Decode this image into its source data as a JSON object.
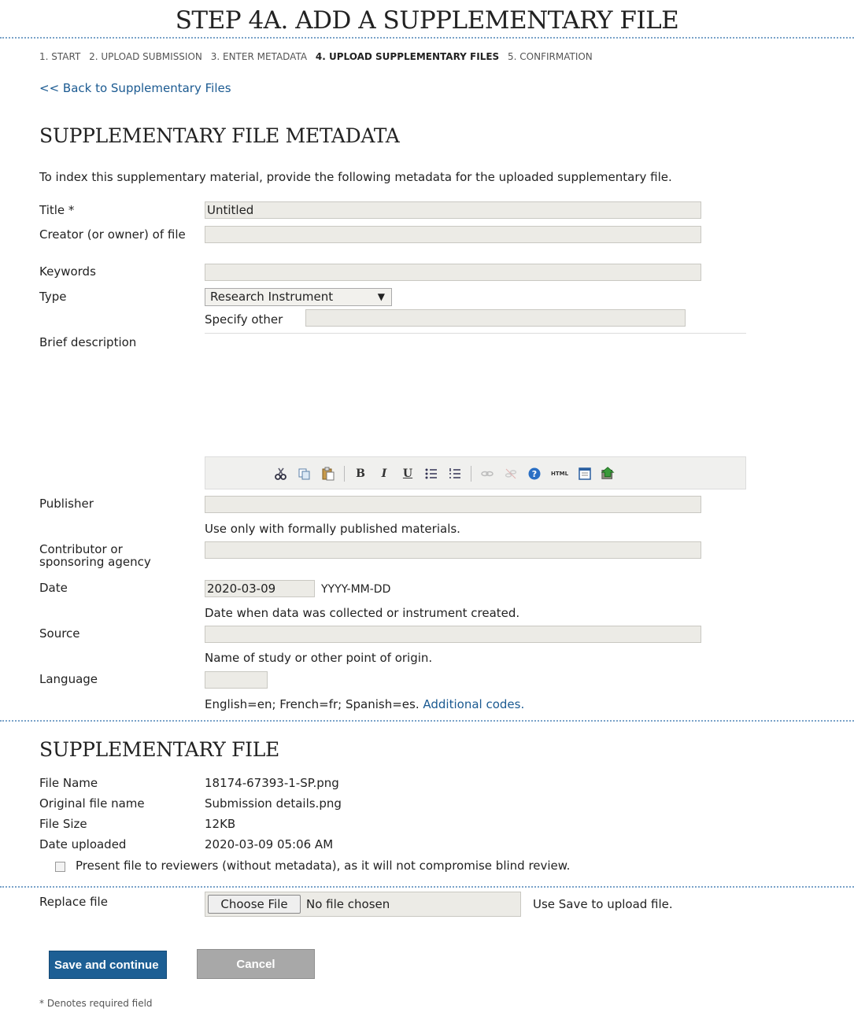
{
  "page_title": "STEP 4A. ADD A SUPPLEMENTARY FILE",
  "steps": [
    {
      "label": "1. START",
      "current": false
    },
    {
      "label": "2. UPLOAD SUBMISSION",
      "current": false
    },
    {
      "label": "3. ENTER METADATA",
      "current": false
    },
    {
      "label": "4. UPLOAD SUPPLEMENTARY FILES",
      "current": true
    },
    {
      "label": "5. CONFIRMATION",
      "current": false
    }
  ],
  "back_link": "<< Back to Supplementary Files",
  "metadata_section": {
    "heading": "SUPPLEMENTARY FILE METADATA",
    "intro": "To index this supplementary material, provide the following metadata for the uploaded supplementary file.",
    "title_label": "Title *",
    "title_value": "Untitled",
    "creator_label": "Creator (or owner) of file",
    "keywords_label": "Keywords",
    "type_label": "Type",
    "type_value": "Research Instrument",
    "specify_other_label": "Specify other",
    "description_label": "Brief description",
    "publisher_label": "Publisher",
    "publisher_note": "Use only with formally published materials.",
    "contributor_label": "Contributor or sponsoring agency",
    "date_label": "Date",
    "date_value": "2020-03-09",
    "date_format": "YYYY-MM-DD",
    "date_note": "Date when data was collected or instrument created.",
    "source_label": "Source",
    "source_note": "Name of study or other point of origin.",
    "language_label": "Language",
    "language_note": "English=en; French=fr; Spanish=es.",
    "language_link": "Additional codes."
  },
  "editor_toolbar": {
    "icons": [
      "cut-icon",
      "copy-icon",
      "paste-icon",
      "bold-icon",
      "italic-icon",
      "underline-icon",
      "bullet-list-icon",
      "numbered-list-icon",
      "link-icon",
      "unlink-icon",
      "help-icon",
      "html-icon",
      "fullscreen-icon",
      "image-upload-icon"
    ],
    "bold": "B",
    "italic": "I",
    "underline": "U",
    "html": "HTML"
  },
  "file_section": {
    "heading": "SUPPLEMENTARY FILE",
    "file_name_label": "File Name",
    "file_name": "18174-67393-1-SP.png",
    "original_name_label": "Original file name",
    "original_name": "Submission details.png",
    "file_size_label": "File Size",
    "file_size": "12KB",
    "date_uploaded_label": "Date uploaded",
    "date_uploaded": "2020-03-09 05:06 AM",
    "present_checkbox_label": "Present file to reviewers (without metadata), as it will not compromise blind review.",
    "present_checked": false,
    "replace_label": "Replace file",
    "choose_file_button": "Choose File",
    "no_file_text": "No file chosen",
    "replace_note": "Use Save to upload file."
  },
  "buttons": {
    "save": "Save and continue",
    "cancel": "Cancel"
  },
  "footnote": "* Denotes required field"
}
